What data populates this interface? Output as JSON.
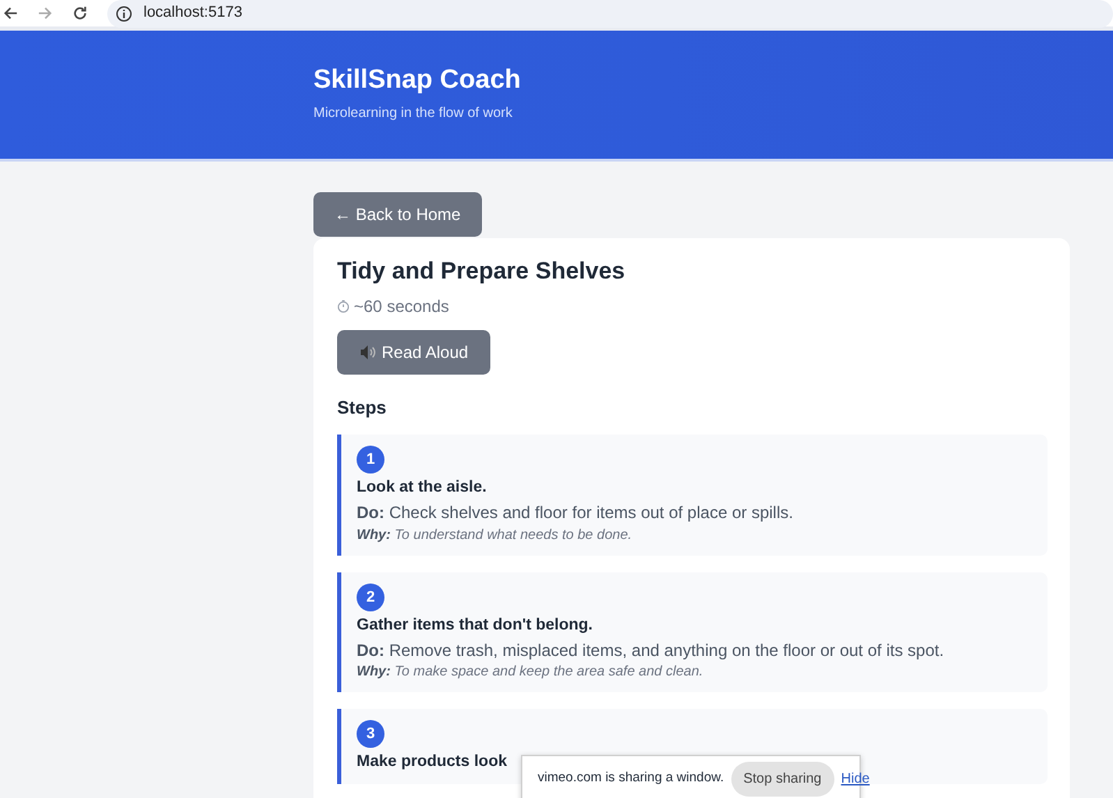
{
  "browser": {
    "url": "localhost:5173",
    "forward_disabled": true
  },
  "header": {
    "title": "SkillSnap Coach",
    "subtitle": "Microlearning in the flow of work"
  },
  "back_button": "← Back to Home",
  "lesson": {
    "title": "Tidy and Prepare Shelves",
    "duration": "~60 seconds",
    "read_aloud": "Read Aloud",
    "steps_heading": "Steps",
    "steps": [
      {
        "number": "1",
        "title": "Look at the aisle.",
        "do": "**Do:** Check shelves and floor for items out of place or spills.",
        "why": "**Why:** To understand what needs to be done."
      },
      {
        "number": "2",
        "title": "Gather items that don't belong.",
        "do": "**Do:** Remove trash, misplaced items, and anything on the floor or out of its spot.",
        "why": "**Why:** To make space and keep the area safe and clean."
      },
      {
        "number": "3",
        "title": "Make products look"
      }
    ]
  },
  "sharing_bar": {
    "message": "vimeo.com is sharing a window.",
    "stop_button": "Stop sharing",
    "hide_link": "Hide"
  }
}
